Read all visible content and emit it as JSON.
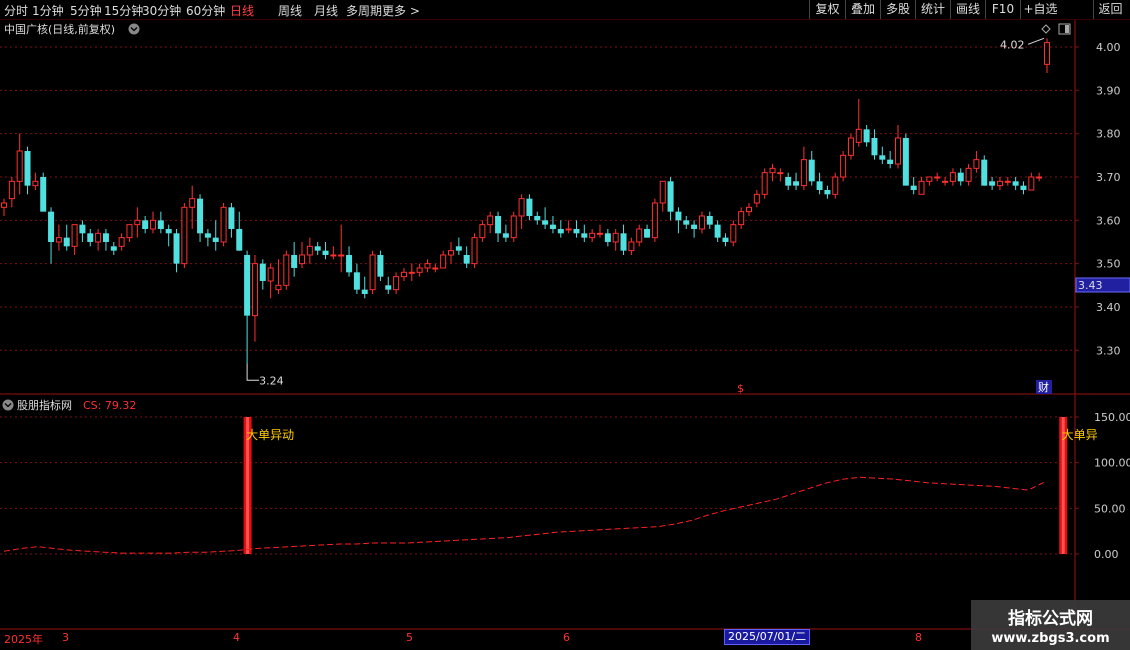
{
  "toolbar": {
    "periods": [
      "分时",
      "1分钟",
      "5分钟",
      "15分钟",
      "30分钟",
      "60分钟",
      "日线",
      "周线",
      "月线",
      "多周期",
      "更多 >"
    ],
    "active_period": "日线",
    "right_buttons": [
      "复权",
      "叠加",
      "多股",
      "统计",
      "画线",
      "F10",
      "+自选",
      "返回"
    ]
  },
  "main_panel": {
    "title": "中国广核(日线,前复权)",
    "price_labels": [
      "4.00",
      "3.90",
      "3.80",
      "3.70",
      "3.60",
      "3.50",
      "3.40",
      "3.30"
    ],
    "current_price": "3.43",
    "high_annotation": "4.02",
    "low_annotation": "3.24",
    "marker_s": "$",
    "marker_cai": "财"
  },
  "indicator_panel": {
    "title": "股朋指标网",
    "cs_label": "CS: 79.32",
    "axis_labels": [
      "150.00",
      "100.00",
      "50.00",
      "0.00"
    ],
    "signal_label": "大单异动",
    "signal_label_cut": "大单异"
  },
  "date_axis": {
    "labels": [
      "2025年",
      "3",
      "4",
      "5",
      "6",
      "8"
    ],
    "cursor_date": "2025/07/01/二"
  },
  "watermark": {
    "line1": "指标公式网",
    "line2": "www.zbgs3.com"
  },
  "colors": {
    "up": "#ff3030",
    "down": "#50e0e0",
    "grid": "#7a1010",
    "cs_line": "#ff2020"
  },
  "chart_data": {
    "type": "candlestick",
    "price_axis": {
      "min": 3.24,
      "max": 4.02
    },
    "indicator_axis": {
      "min": 0,
      "max": 150
    },
    "candles": [
      [
        3.63,
        3.65,
        3.61,
        3.64
      ],
      [
        3.65,
        3.7,
        3.63,
        3.69
      ],
      [
        3.69,
        3.8,
        3.66,
        3.76
      ],
      [
        3.76,
        3.77,
        3.66,
        3.68
      ],
      [
        3.68,
        3.71,
        3.67,
        3.69
      ],
      [
        3.7,
        3.71,
        3.63,
        3.62
      ],
      [
        3.62,
        3.63,
        3.5,
        3.55
      ],
      [
        3.55,
        3.59,
        3.53,
        3.56
      ],
      [
        3.56,
        3.59,
        3.53,
        3.54
      ],
      [
        3.54,
        3.59,
        3.52,
        3.59
      ],
      [
        3.59,
        3.6,
        3.55,
        3.57
      ],
      [
        3.57,
        3.58,
        3.54,
        3.55
      ],
      [
        3.55,
        3.58,
        3.53,
        3.57
      ],
      [
        3.57,
        3.58,
        3.53,
        3.55
      ],
      [
        3.54,
        3.55,
        3.52,
        3.53
      ],
      [
        3.54,
        3.57,
        3.53,
        3.56
      ],
      [
        3.56,
        3.59,
        3.55,
        3.59
      ],
      [
        3.59,
        3.63,
        3.56,
        3.6
      ],
      [
        3.6,
        3.61,
        3.57,
        3.58
      ],
      [
        3.58,
        3.62,
        3.57,
        3.6
      ],
      [
        3.6,
        3.62,
        3.57,
        3.58
      ],
      [
        3.58,
        3.59,
        3.54,
        3.57
      ],
      [
        3.57,
        3.58,
        3.48,
        3.5
      ],
      [
        3.5,
        3.64,
        3.49,
        3.63
      ],
      [
        3.63,
        3.68,
        3.58,
        3.65
      ],
      [
        3.65,
        3.66,
        3.55,
        3.57
      ],
      [
        3.57,
        3.58,
        3.54,
        3.56
      ],
      [
        3.56,
        3.6,
        3.53,
        3.55
      ],
      [
        3.55,
        3.64,
        3.54,
        3.63
      ],
      [
        3.63,
        3.64,
        3.56,
        3.58
      ],
      [
        3.58,
        3.62,
        3.53,
        3.53
      ],
      [
        3.52,
        3.53,
        3.27,
        3.38
      ],
      [
        3.38,
        3.52,
        3.32,
        3.5
      ],
      [
        3.5,
        3.51,
        3.44,
        3.46
      ],
      [
        3.46,
        3.5,
        3.42,
        3.49
      ],
      [
        3.44,
        3.51,
        3.43,
        3.45
      ],
      [
        3.45,
        3.53,
        3.44,
        3.52
      ],
      [
        3.52,
        3.55,
        3.47,
        3.49
      ],
      [
        3.5,
        3.55,
        3.49,
        3.52
      ],
      [
        3.52,
        3.56,
        3.5,
        3.54
      ],
      [
        3.54,
        3.55,
        3.52,
        3.53
      ],
      [
        3.53,
        3.55,
        3.51,
        3.52
      ],
      [
        3.52,
        3.54,
        3.51,
        3.52
      ],
      [
        3.52,
        3.59,
        3.48,
        3.52
      ],
      [
        3.52,
        3.54,
        3.47,
        3.48
      ],
      [
        3.48,
        3.5,
        3.43,
        3.44
      ],
      [
        3.44,
        3.47,
        3.42,
        3.43
      ],
      [
        3.44,
        3.53,
        3.43,
        3.52
      ],
      [
        3.52,
        3.53,
        3.46,
        3.47
      ],
      [
        3.45,
        3.47,
        3.43,
        3.44
      ],
      [
        3.44,
        3.48,
        3.43,
        3.47
      ],
      [
        3.47,
        3.49,
        3.46,
        3.48
      ],
      [
        3.48,
        3.5,
        3.46,
        3.48
      ],
      [
        3.48,
        3.5,
        3.47,
        3.49
      ],
      [
        3.49,
        3.51,
        3.48,
        3.5
      ],
      [
        3.49,
        3.5,
        3.48,
        3.49
      ],
      [
        3.49,
        3.53,
        3.49,
        3.52
      ],
      [
        3.52,
        3.55,
        3.5,
        3.53
      ],
      [
        3.54,
        3.56,
        3.52,
        3.53
      ],
      [
        3.52,
        3.54,
        3.49,
        3.5
      ],
      [
        3.5,
        3.57,
        3.49,
        3.56
      ],
      [
        3.56,
        3.6,
        3.55,
        3.59
      ],
      [
        3.59,
        3.62,
        3.57,
        3.61
      ],
      [
        3.61,
        3.62,
        3.55,
        3.57
      ],
      [
        3.57,
        3.59,
        3.55,
        3.56
      ],
      [
        3.56,
        3.62,
        3.55,
        3.61
      ],
      [
        3.61,
        3.66,
        3.58,
        3.65
      ],
      [
        3.65,
        3.66,
        3.6,
        3.61
      ],
      [
        3.61,
        3.62,
        3.59,
        3.6
      ],
      [
        3.6,
        3.63,
        3.58,
        3.59
      ],
      [
        3.59,
        3.61,
        3.57,
        3.58
      ],
      [
        3.58,
        3.6,
        3.56,
        3.57
      ],
      [
        3.58,
        3.6,
        3.57,
        3.58
      ],
      [
        3.58,
        3.6,
        3.56,
        3.57
      ],
      [
        3.57,
        3.59,
        3.55,
        3.56
      ],
      [
        3.56,
        3.58,
        3.55,
        3.57
      ],
      [
        3.57,
        3.59,
        3.56,
        3.57
      ],
      [
        3.57,
        3.58,
        3.54,
        3.55
      ],
      [
        3.55,
        3.58,
        3.53,
        3.57
      ],
      [
        3.57,
        3.59,
        3.52,
        3.53
      ],
      [
        3.53,
        3.56,
        3.52,
        3.55
      ],
      [
        3.55,
        3.59,
        3.54,
        3.58
      ],
      [
        3.58,
        3.59,
        3.56,
        3.56
      ],
      [
        3.56,
        3.65,
        3.55,
        3.64
      ],
      [
        3.64,
        3.69,
        3.62,
        3.69
      ],
      [
        3.69,
        3.7,
        3.6,
        3.62
      ],
      [
        3.62,
        3.63,
        3.57,
        3.6
      ],
      [
        3.6,
        3.61,
        3.58,
        3.59
      ],
      [
        3.59,
        3.6,
        3.56,
        3.58
      ],
      [
        3.58,
        3.62,
        3.57,
        3.61
      ],
      [
        3.61,
        3.62,
        3.58,
        3.59
      ],
      [
        3.59,
        3.6,
        3.55,
        3.56
      ],
      [
        3.56,
        3.57,
        3.54,
        3.55
      ],
      [
        3.55,
        3.6,
        3.54,
        3.59
      ],
      [
        3.59,
        3.63,
        3.58,
        3.62
      ],
      [
        3.62,
        3.64,
        3.61,
        3.63
      ],
      [
        3.64,
        3.67,
        3.63,
        3.66
      ],
      [
        3.66,
        3.72,
        3.65,
        3.71
      ],
      [
        3.71,
        3.73,
        3.69,
        3.72
      ],
      [
        3.71,
        3.72,
        3.69,
        3.71
      ],
      [
        3.7,
        3.71,
        3.67,
        3.68
      ],
      [
        3.69,
        3.71,
        3.67,
        3.68
      ],
      [
        3.68,
        3.77,
        3.67,
        3.74
      ],
      [
        3.74,
        3.76,
        3.68,
        3.69
      ],
      [
        3.69,
        3.71,
        3.66,
        3.67
      ],
      [
        3.67,
        3.68,
        3.65,
        3.66
      ],
      [
        3.66,
        3.71,
        3.65,
        3.7
      ],
      [
        3.7,
        3.76,
        3.69,
        3.75
      ],
      [
        3.75,
        3.8,
        3.74,
        3.79
      ],
      [
        3.78,
        3.88,
        3.77,
        3.81
      ],
      [
        3.81,
        3.82,
        3.77,
        3.78
      ],
      [
        3.79,
        3.81,
        3.74,
        3.75
      ],
      [
        3.75,
        3.77,
        3.73,
        3.74
      ],
      [
        3.74,
        3.76,
        3.72,
        3.73
      ],
      [
        3.73,
        3.82,
        3.72,
        3.79
      ],
      [
        3.79,
        3.8,
        3.69,
        3.68
      ],
      [
        3.68,
        3.7,
        3.66,
        3.67
      ],
      [
        3.66,
        3.7,
        3.66,
        3.69
      ],
      [
        3.69,
        3.7,
        3.68,
        3.7
      ],
      [
        3.7,
        3.71,
        3.69,
        3.7
      ],
      [
        3.69,
        3.7,
        3.68,
        3.69
      ],
      [
        3.69,
        3.72,
        3.68,
        3.71
      ],
      [
        3.71,
        3.72,
        3.68,
        3.69
      ],
      [
        3.69,
        3.73,
        3.68,
        3.72
      ],
      [
        3.72,
        3.76,
        3.71,
        3.74
      ],
      [
        3.74,
        3.75,
        3.68,
        3.68
      ],
      [
        3.69,
        3.7,
        3.67,
        3.68
      ],
      [
        3.68,
        3.7,
        3.67,
        3.69
      ],
      [
        3.69,
        3.7,
        3.68,
        3.69
      ],
      [
        3.69,
        3.7,
        3.67,
        3.68
      ],
      [
        3.68,
        3.69,
        3.66,
        3.67
      ],
      [
        3.67,
        3.71,
        3.67,
        3.7
      ],
      [
        3.7,
        3.71,
        3.69,
        3.7
      ],
      [
        3.96,
        4.02,
        3.94,
        4.01
      ]
    ],
    "cs_values": [
      3,
      6,
      8,
      6,
      4,
      3,
      2,
      1,
      1,
      1,
      1,
      2,
      2,
      3,
      4,
      6,
      7,
      8,
      9,
      10,
      11,
      11,
      12,
      12,
      12,
      13,
      14,
      15,
      16,
      17,
      18,
      20,
      22,
      24,
      25,
      26,
      27,
      28,
      29,
      30,
      33,
      37,
      43,
      48,
      52,
      56,
      60,
      66,
      72,
      78,
      82,
      84,
      83,
      82,
      80,
      78,
      77,
      76,
      75,
      74,
      72,
      70,
      79
    ],
    "signals": [
      {
        "date_index": 31,
        "label": "大单异动"
      },
      {
        "date_index": 135,
        "label": "大单异"
      }
    ]
  }
}
